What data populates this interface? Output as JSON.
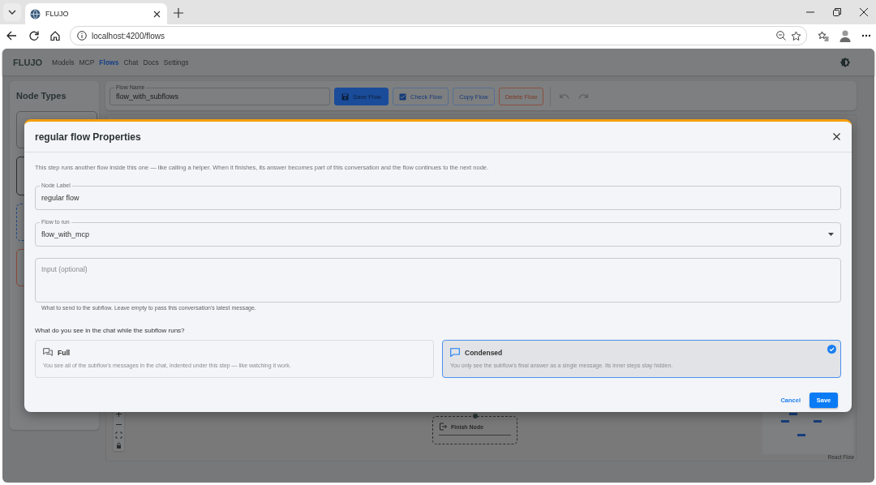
{
  "browser": {
    "tabs": [
      {
        "title": "FLUJO",
        "selected": true
      }
    ],
    "url": "localhost:4200/flows"
  },
  "app": {
    "brand": "FLUJO",
    "nav": [
      {
        "label": "Models",
        "selected": false
      },
      {
        "label": "MCP",
        "selected": false
      },
      {
        "label": "Flows",
        "selected": true
      },
      {
        "label": "Chat",
        "selected": false
      },
      {
        "label": "Docs",
        "selected": false
      },
      {
        "label": "Settings",
        "selected": false
      }
    ]
  },
  "sidebar": {
    "title": "Node Types",
    "cards": [
      {
        "kind": "plain"
      },
      {
        "kind": "dark"
      },
      {
        "kind": "dashed"
      },
      {
        "kind": "danger"
      }
    ]
  },
  "toolbar": {
    "flow_name": {
      "label": "Flow Name",
      "value": "flow_with_subflows"
    },
    "buttons": [
      {
        "label": "Save Flow",
        "kind": "primary"
      },
      {
        "label": "Check Flow",
        "kind": "check"
      },
      {
        "label": "Copy Flow",
        "kind": "outlined"
      },
      {
        "label": "Delete Flow",
        "kind": "danger"
      }
    ]
  },
  "canvas": {
    "nodes": [
      {
        "label": "Finish Node"
      }
    ],
    "attribution": "React Flow"
  },
  "dialog": {
    "title": "regular flow Properties",
    "description": "This step runs another flow inside this one — like calling a helper. When it finishes, its answer becomes part of this conversation and the flow continues to the next node.",
    "fields": [
      {
        "kind": "text",
        "label": "Node Label",
        "value": "regular flow"
      },
      {
        "kind": "select",
        "label": "Flow to run",
        "value": "flow_with_mcp"
      },
      {
        "kind": "textarea",
        "placeholder": "Input (optional)",
        "helper": "What to send to the subflow. Leave empty to pass this conversation's latest message."
      }
    ],
    "question": "What do you see in the chat while the subflow runs?",
    "options": [
      {
        "kind": "full",
        "title": "Full",
        "description": "You see all of the subflow's messages in the chat, indented under this step — like watching it work.",
        "selected": false
      },
      {
        "kind": "condensed",
        "title": "Condensed",
        "description": "You only see the subflow's final answer as a single message. Its inner steps stay hidden.",
        "selected": true
      }
    ],
    "actions": [
      {
        "label": "Cancel",
        "kind": "text"
      },
      {
        "label": "Save",
        "kind": "primary"
      }
    ]
  }
}
